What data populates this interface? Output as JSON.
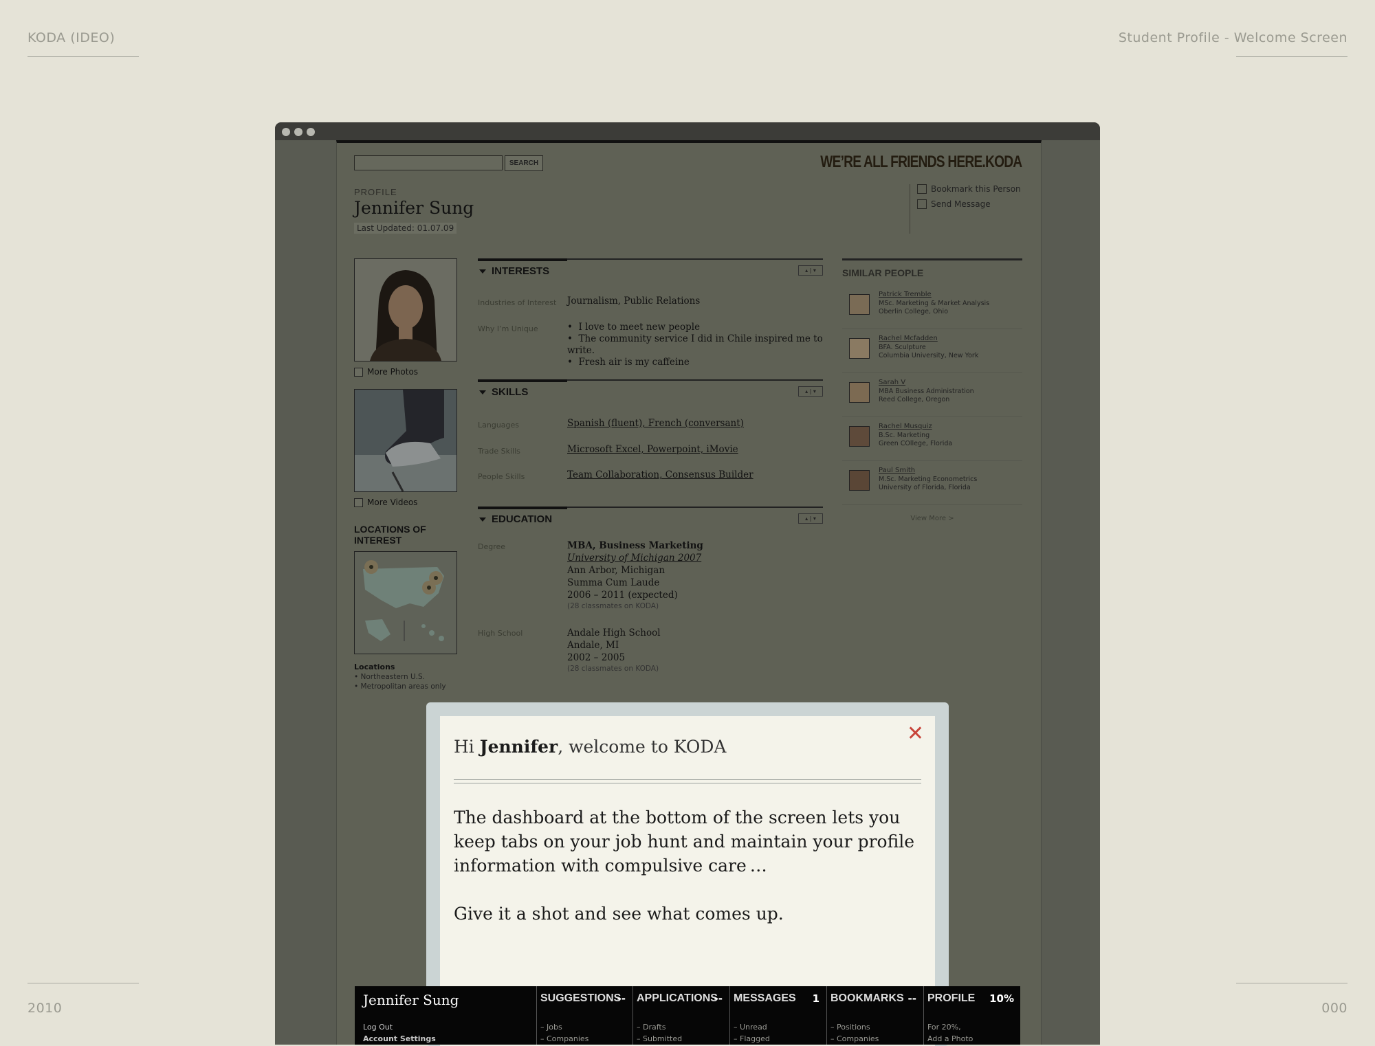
{
  "corners": {
    "top_left": "KODA (IDEO)",
    "top_right": "Student Profile - Welcome Screen",
    "bottom_left": "2010",
    "bottom_right": "000"
  },
  "header": {
    "search_button": "SEARCH",
    "tagline": "WE’RE ALL FRIENDS HERE.",
    "brand": "KODA"
  },
  "profile": {
    "label": "PROFILE",
    "name": "Jennifer Sung",
    "last_updated_label": "Last Updated:",
    "last_updated": "01.07.09",
    "actions": [
      "Bookmark this Person",
      "Send Message"
    ]
  },
  "left": {
    "more_photos": "More Photos",
    "more_videos": "More Videos",
    "locations_heading": "LOCATIONS OF INTEREST",
    "locations_label": "Locations",
    "locations": [
      "• Northeastern U.S.",
      "• Metropolitan areas only"
    ]
  },
  "interests": {
    "title": "INTERESTS",
    "rows": [
      {
        "label": "Industries of Interest",
        "value": "Journalism, Public Relations"
      },
      {
        "label": "Why I’m Unique",
        "bullets": [
          "I love to meet new people",
          "The community service I did in Chile inspired me to write.",
          "Fresh air is my caffeine"
        ]
      }
    ]
  },
  "skills": {
    "title": "SKILLS",
    "rows": [
      {
        "label": "Languages",
        "value": "Spanish (fluent), French (conversant)"
      },
      {
        "label": "Trade Skills",
        "value": "Microsoft Excel, Powerpoint, iMovie"
      },
      {
        "label": "People Skills",
        "value": "Team Collaboration, Consensus Builder"
      }
    ]
  },
  "education": {
    "title": "EDUCATION",
    "degree": {
      "label": "Degree",
      "lines": [
        "MBA, Business Marketing",
        "University of Michigan 2007",
        "Ann Arbor, Michigan",
        "Summa Cum Laude",
        "2006 – 2011 (expected)"
      ],
      "note": "(28 classmates on KODA)"
    },
    "highschool": {
      "label": "High School",
      "lines": [
        "Andale High School",
        "Andale, MI",
        "2002 – 2005"
      ],
      "note": "(28 classmates on KODA)"
    }
  },
  "similar": {
    "title": "SIMILAR PEOPLE",
    "view_more": "View More >",
    "people": [
      {
        "name": "Patrick Tremble",
        "line1": "MSc. Marketing & Market Analysis",
        "line2": "Oberlin College, Ohio"
      },
      {
        "name": "Rachel Mcfadden",
        "line1": "BFA. Sculpture",
        "line2": "Columbia University, New York"
      },
      {
        "name": "Sarah V",
        "line1": "MBA Business Administration",
        "line2": "Reed College, Oregon"
      },
      {
        "name": "Rachel Musquiz",
        "line1": "B.Sc. Marketing",
        "line2": "Green COllege, Florida"
      },
      {
        "name": "Paul Smith",
        "line1": "M.Sc. Marketing Econometrics",
        "line2": "University of Florida, Florida"
      }
    ]
  },
  "modal": {
    "hi": "Hi",
    "name": "Jennifer",
    "welcome": ", welcome to KODA",
    "p1": "The dashboard at the bottom of the screen lets you keep tabs on your job hunt and maintain your profile information with compulsive care …",
    "p2": "Give it a shot and see what comes up."
  },
  "dashboard": {
    "name": "Jennifer Sung",
    "log_out": "Log Out",
    "account_settings": "Account Settings",
    "tabs": [
      {
        "title": "SUGGESTIONS",
        "count": "--",
        "sub1": "– Jobs",
        "sub2": "– Companies"
      },
      {
        "title": "APPLICATIONS",
        "count": "--",
        "sub1": "– Drafts",
        "sub2": "– Submitted"
      },
      {
        "title": "MESSAGES",
        "count": "1",
        "sub1": "– Unread",
        "sub2": "– Flagged"
      },
      {
        "title": "BOOKMARKS",
        "count": "--",
        "sub1": "– Positions",
        "sub2": "– Companies"
      },
      {
        "title": "PROFILE",
        "count": "10%",
        "sub1": "For 20%,",
        "sub2": "Add a Photo"
      }
    ]
  }
}
